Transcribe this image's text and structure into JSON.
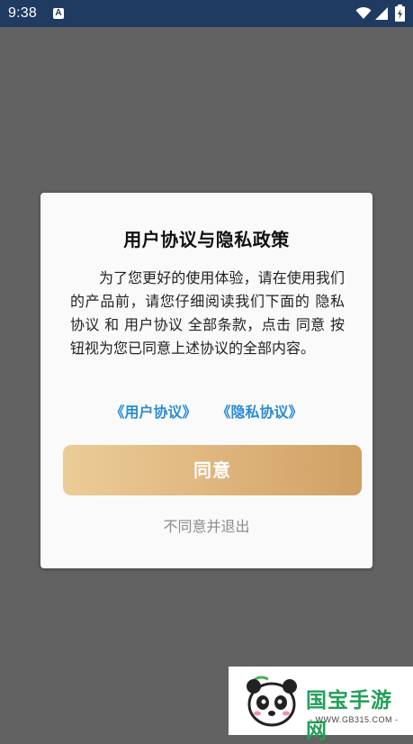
{
  "status_bar": {
    "time": "9:38",
    "notification_icon_letter": "A",
    "icons": [
      "wifi-icon",
      "signal-icon",
      "battery-icon"
    ]
  },
  "dialog": {
    "title": "用户协议与隐私政策",
    "body": "为了您更好的使用体验，请在使用我们的产品前，请您仔细阅读我们下面的 隐私协议 和 用户协议 全部条款，点击 同意 按钮视为您已同意上述协议的全部内容。",
    "user_agreement_link": "《用户协议》",
    "privacy_link": "《隐私协议》",
    "agree_button": "同意",
    "decline_button": "不同意并退出"
  },
  "watermark": {
    "title": "国宝手游网",
    "url": "- WWW.GB315.COM -"
  },
  "colors": {
    "status_bar": "#1f3b62",
    "overlay": "#626262",
    "link": "#2a8bd6",
    "button_gradient_start": "#ebcc97",
    "button_gradient_end": "#cfa063",
    "watermark_green": "#22a05a"
  }
}
